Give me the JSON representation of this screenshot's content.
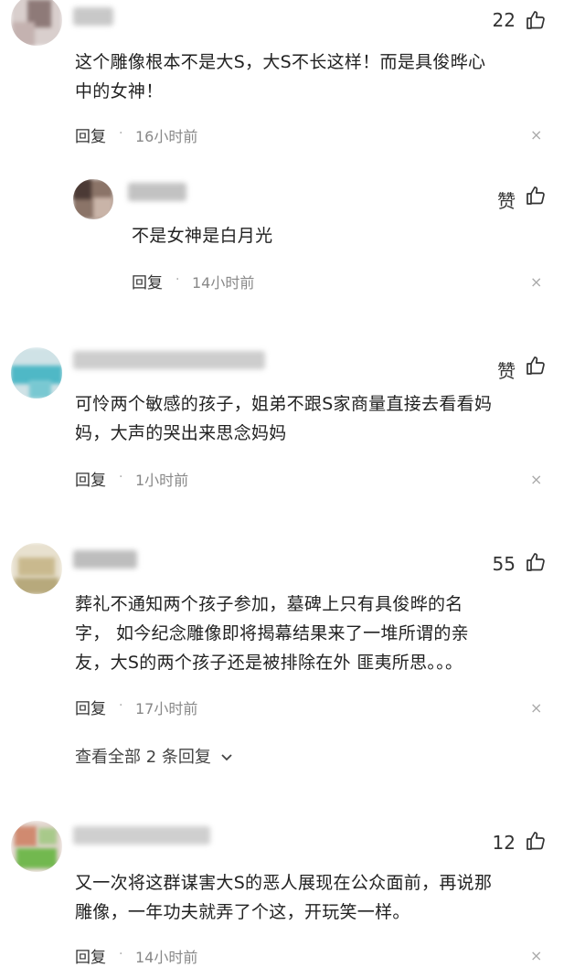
{
  "colors": {
    "text": "#222222",
    "meta": "#888888",
    "background": "#ffffff"
  },
  "comments": [
    {
      "likes": "22",
      "text_lines": [
        "这个雕像根本不是大S，大S不长这样！而是具俊晔心",
        "中的女神！"
      ],
      "reply_label": "回复",
      "dot": "·",
      "time": "16小时前",
      "close": "×",
      "reply": {
        "likes": "赞",
        "text_lines": [
          "不是女神是白月光"
        ],
        "reply_label": "回复",
        "dot": "·",
        "time": "14小时前",
        "close": "×"
      }
    },
    {
      "likes": "赞",
      "text_lines": [
        "可怜两个敏感的孩子，姐弟不跟S家商量直接去看看妈",
        "妈，大声的哭出来思念妈妈"
      ],
      "reply_label": "回复",
      "dot": "·",
      "time": "1小时前",
      "close": "×"
    },
    {
      "likes": "55",
      "text_lines": [
        "葬礼不通知两个孩子参加，墓碑上只有具俊晔的名",
        "字， 如今纪念雕像即将揭幕结果来了一堆所谓的亲",
        "友，大S的两个孩子还是被排除在外 匪夷所思。。。"
      ],
      "reply_label": "回复",
      "dot": "·",
      "time": "17小时前",
      "close": "×",
      "view_all": "查看全部 2 条回复"
    },
    {
      "likes": "12",
      "text_lines": [
        "又一次将这群谋害大S的恶人展现在公众面前，再说那",
        "雕像，一年功夫就弄了个这，开玩笑一样。"
      ],
      "reply_label": "回复",
      "dot": "·",
      "time": "14小时前",
      "close": "×"
    }
  ]
}
